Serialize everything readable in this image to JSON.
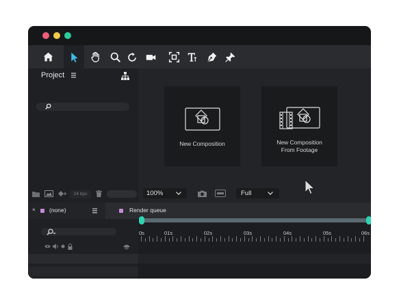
{
  "window": {
    "traffic_lights": [
      "#f05d7a",
      "#f2c94c",
      "#2ecc9b"
    ]
  },
  "toolbar": {
    "tools": [
      {
        "name": "home-icon",
        "active": false
      },
      {
        "name": "selection-arrow-icon",
        "active": true
      },
      {
        "name": "hand-icon",
        "active": false
      },
      {
        "name": "zoom-icon",
        "active": false
      },
      {
        "name": "rotate-icon",
        "active": false
      },
      {
        "name": "camera-icon",
        "active": false
      },
      {
        "name": "region-select-icon",
        "active": false
      },
      {
        "name": "text-icon",
        "active": false
      },
      {
        "name": "pen-icon",
        "active": false
      },
      {
        "name": "pin-icon",
        "active": false
      }
    ],
    "accent": "#3fb9e8"
  },
  "project": {
    "title": "Project",
    "search_placeholder": ""
  },
  "viewer": {
    "cards": [
      {
        "label": "New Composition"
      },
      {
        "label_line1": "New Composition",
        "label_line2": "From Footage"
      }
    ]
  },
  "statusbar": {
    "fps": "24 bps",
    "zoom": "100%",
    "resolution": "Full"
  },
  "timeline": {
    "tab_none_label": "(none)",
    "tab_render_label": "Render queue",
    "tab_color": "#c58bd8",
    "work_area_color": "#2fd3b0",
    "ruler_labels": [
      "0s",
      "01s",
      "02s",
      "03s",
      "04s",
      "05s",
      "06s"
    ]
  }
}
